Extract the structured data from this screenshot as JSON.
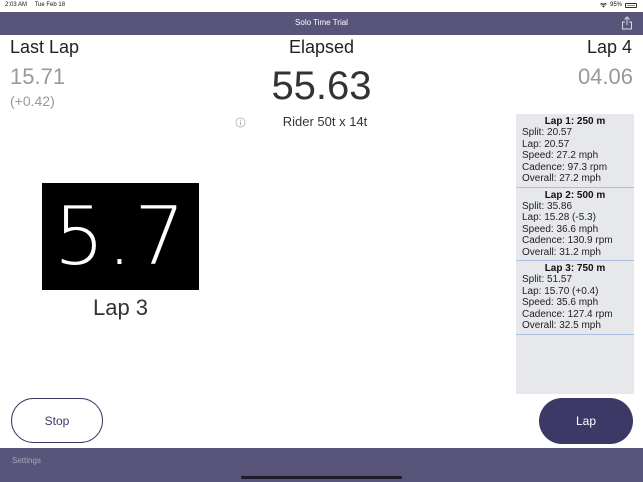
{
  "status": {
    "time": "2:03 AM",
    "date": "Tue Feb 18",
    "battery": "95%"
  },
  "nav": {
    "title": "Solo Time Trial"
  },
  "left": {
    "label": "Last Lap",
    "value": "15.71",
    "delta": "(+0.42)"
  },
  "center": {
    "label": "Elapsed",
    "value": "55.63",
    "rider": "Rider 50t x 14t"
  },
  "right": {
    "label": "Lap 4",
    "value": "04.06"
  },
  "speed": {
    "value": "5.7",
    "lap_label": "Lap 3"
  },
  "laps": [
    {
      "title": "Lap 1: 250 m",
      "lines": [
        "Split: 20.57",
        "Lap: 20.57",
        "Speed: 27.2 mph",
        "Cadence: 97.3 rpm",
        "Overall: 27.2 mph"
      ]
    },
    {
      "title": "Lap 2: 500 m",
      "lines": [
        "Split: 35.86",
        "Lap: 15.28 (-5.3)",
        "Speed: 36.6 mph",
        "Cadence: 130.9 rpm",
        "Overall: 31.2 mph"
      ]
    },
    {
      "title": "Lap 3: 750 m",
      "lines": [
        "Split: 51.57",
        "Lap: 15.70 (+0.4)",
        "Speed: 35.6 mph",
        "Cadence: 127.4 rpm",
        "Overall: 32.5 mph"
      ]
    }
  ],
  "buttons": {
    "stop": "Stop",
    "lap": "Lap"
  },
  "footer": {
    "settings": "Settings"
  },
  "colors": {
    "accent": "#3c3966",
    "nav_bg": "#58547a"
  },
  "icons": {
    "share": "share-icon",
    "info": "info-icon",
    "wifi": "wifi-icon",
    "battery": "battery-icon"
  }
}
